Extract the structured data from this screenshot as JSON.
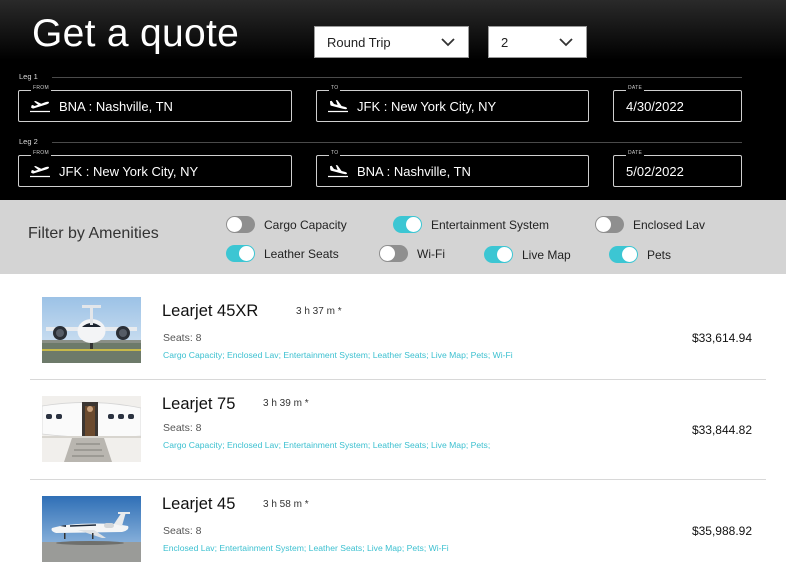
{
  "header": {
    "title": "Get a quote",
    "trip_type": "Round Trip",
    "passengers": "2"
  },
  "legs": [
    {
      "label": "Leg 1",
      "from_tag": "FROM",
      "from": "BNA : Nashville, TN",
      "to_tag": "TO",
      "to": "JFK : New York City, NY",
      "date_tag": "DATE",
      "date": "4/30/2022"
    },
    {
      "label": "Leg 2",
      "from_tag": "FROM",
      "from": "JFK : New York City, NY",
      "to_tag": "TO",
      "to": "BNA : Nashville, TN",
      "date_tag": "DATE",
      "date": "5/02/2022"
    }
  ],
  "filters": {
    "title": "Filter by Amenities",
    "items": [
      {
        "label": "Cargo Capacity",
        "on": false
      },
      {
        "label": "Entertainment System",
        "on": true
      },
      {
        "label": "Enclosed Lav",
        "on": false
      },
      {
        "label": "Leather Seats",
        "on": true
      },
      {
        "label": "Wi-Fi",
        "on": false
      },
      {
        "label": "Live Map",
        "on": true
      },
      {
        "label": "Pets",
        "on": true
      }
    ]
  },
  "results": [
    {
      "name": "Learjet 45XR",
      "time": "3 h 37 m *",
      "seats": "Seats: 8",
      "amenities": "Cargo Capacity; Enclosed Lav; Entertainment System; Leather Seats; Live Map; Pets; Wi-Fi",
      "price": "$33,614.94"
    },
    {
      "name": "Learjet 75",
      "time": "3 h 39 m *",
      "seats": "Seats: 8",
      "amenities": "Cargo Capacity; Enclosed Lav; Entertainment System; Leather Seats; Live Map; Pets;",
      "price": "$33,844.82"
    },
    {
      "name": "Learjet 45",
      "time": "3 h 58 m *",
      "seats": "Seats: 8",
      "amenities": "Enclosed Lav; Entertainment System; Leather Seats; Live Map; Pets; Wi-Fi",
      "price": "$35,988.92"
    }
  ],
  "colors": {
    "accent": "#3cc6d3",
    "toggle_off": "#8f8f8f",
    "filter_bar": "#d4d4d4"
  },
  "icons": {
    "departure": "plane-takeoff-icon",
    "arrival": "plane-landing-icon",
    "dropdown": "chevron-down-icon"
  }
}
